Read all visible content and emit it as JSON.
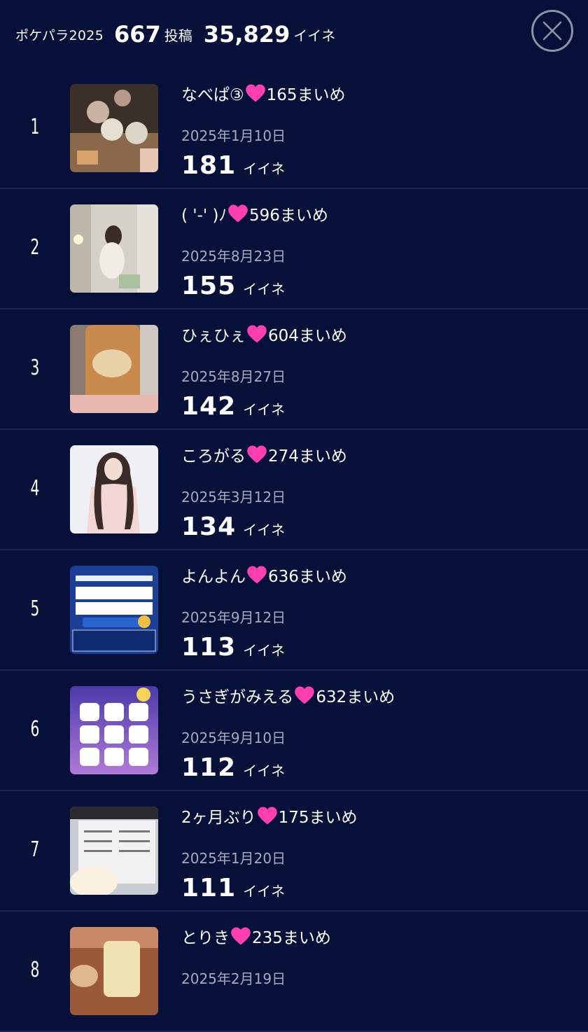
{
  "header": {
    "brand": "ポケパラ2025",
    "posts_count": "667",
    "posts_unit": "投稿",
    "likes_count": "35,829",
    "likes_unit": "イイネ"
  },
  "colors": {
    "background": "#061038",
    "heart": "#ff3fb0",
    "date": "#a7abbd"
  },
  "items": [
    {
      "rank": "1",
      "title_pre": "なべぱ③",
      "title_post": "165まいめ",
      "date": "2025年1月10日",
      "likes": "181",
      "likes_unit": "イイネ"
    },
    {
      "rank": "2",
      "title_pre": "( '-' )ﾉ",
      "title_post": "596まいめ",
      "date": "2025年8月23日",
      "likes": "155",
      "likes_unit": "イイネ"
    },
    {
      "rank": "3",
      "title_pre": "ひぇひぇ",
      "title_post": "604まいめ",
      "date": "2025年8月27日",
      "likes": "142",
      "likes_unit": "イイネ"
    },
    {
      "rank": "4",
      "title_pre": "ころがる",
      "title_post": "274まいめ",
      "date": "2025年3月12日",
      "likes": "134",
      "likes_unit": "イイネ"
    },
    {
      "rank": "5",
      "title_pre": "よんよん",
      "title_post": "636まいめ",
      "date": "2025年9月12日",
      "likes": "113",
      "likes_unit": "イイネ"
    },
    {
      "rank": "6",
      "title_pre": "うさぎがみえる",
      "title_post": "632まいめ",
      "date": "2025年9月10日",
      "likes": "112",
      "likes_unit": "イイネ"
    },
    {
      "rank": "7",
      "title_pre": "2ヶ月ぶり",
      "title_post": "175まいめ",
      "date": "2025年1月20日",
      "likes": "111",
      "likes_unit": "イイネ"
    },
    {
      "rank": "8",
      "title_pre": "とりき",
      "title_post": "235まいめ",
      "date": "2025年2月19日",
      "likes": "",
      "likes_unit": ""
    }
  ]
}
